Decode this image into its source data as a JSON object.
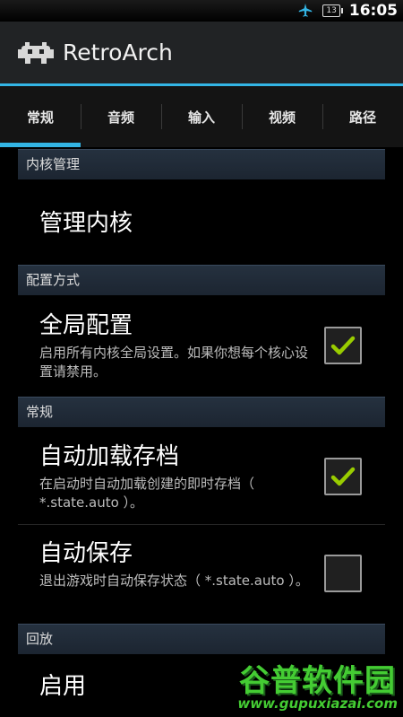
{
  "status_bar": {
    "time": "16:05",
    "battery": "13"
  },
  "app_bar": {
    "title": "RetroArch"
  },
  "tabs": [
    {
      "label": "常规"
    },
    {
      "label": "音频"
    },
    {
      "label": "输入"
    },
    {
      "label": "视频"
    },
    {
      "label": "路径"
    }
  ],
  "sections": {
    "core_management": {
      "header": "内核管理",
      "manage_cores": {
        "title": "管理内核"
      }
    },
    "config_method": {
      "header": "配置方式",
      "global_config": {
        "title": "全局配置",
        "summary": "启用所有内核全局设置。如果你想每个核心设置请禁用。",
        "checked": true
      }
    },
    "general": {
      "header": "常规",
      "auto_load_state": {
        "title": "自动加载存档",
        "summary": "在启动时自动加载创建的即时存档（ *.state.auto ）。",
        "checked": true
      },
      "auto_save": {
        "title": "自动保存",
        "summary": "退出游戏时自动保存状态（ *.state.auto ）。",
        "checked": false
      }
    },
    "rewind": {
      "header": "回放",
      "enable": {
        "title": "启用"
      }
    }
  },
  "watermark": {
    "name": "谷普软件园",
    "url": "www.gupuxiazai.com"
  },
  "colors": {
    "accent": "#33b5e5",
    "check": "#99cc00",
    "watermark": "#44cc33"
  }
}
